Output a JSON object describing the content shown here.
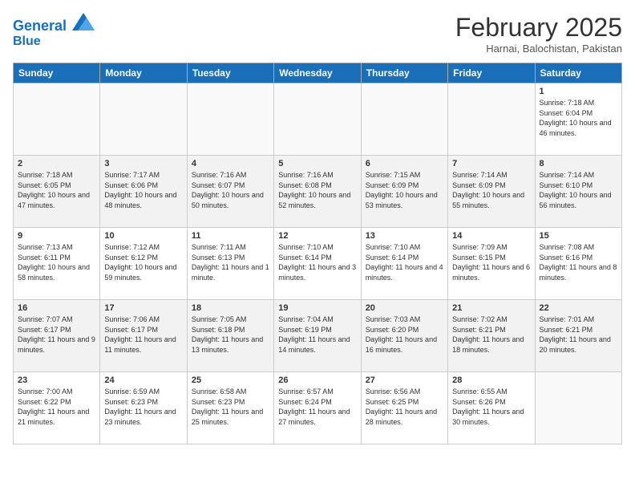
{
  "header": {
    "logo_line1": "General",
    "logo_line2": "Blue",
    "month": "February 2025",
    "location": "Harnai, Balochistan, Pakistan"
  },
  "weekdays": [
    "Sunday",
    "Monday",
    "Tuesday",
    "Wednesday",
    "Thursday",
    "Friday",
    "Saturday"
  ],
  "weeks": [
    {
      "shaded": false,
      "days": [
        {
          "num": "",
          "info": ""
        },
        {
          "num": "",
          "info": ""
        },
        {
          "num": "",
          "info": ""
        },
        {
          "num": "",
          "info": ""
        },
        {
          "num": "",
          "info": ""
        },
        {
          "num": "",
          "info": ""
        },
        {
          "num": "1",
          "info": "Sunrise: 7:18 AM\nSunset: 6:04 PM\nDaylight: 10 hours and 46 minutes."
        }
      ]
    },
    {
      "shaded": true,
      "days": [
        {
          "num": "2",
          "info": "Sunrise: 7:18 AM\nSunset: 6:05 PM\nDaylight: 10 hours and 47 minutes."
        },
        {
          "num": "3",
          "info": "Sunrise: 7:17 AM\nSunset: 6:06 PM\nDaylight: 10 hours and 48 minutes."
        },
        {
          "num": "4",
          "info": "Sunrise: 7:16 AM\nSunset: 6:07 PM\nDaylight: 10 hours and 50 minutes."
        },
        {
          "num": "5",
          "info": "Sunrise: 7:16 AM\nSunset: 6:08 PM\nDaylight: 10 hours and 52 minutes."
        },
        {
          "num": "6",
          "info": "Sunrise: 7:15 AM\nSunset: 6:09 PM\nDaylight: 10 hours and 53 minutes."
        },
        {
          "num": "7",
          "info": "Sunrise: 7:14 AM\nSunset: 6:09 PM\nDaylight: 10 hours and 55 minutes."
        },
        {
          "num": "8",
          "info": "Sunrise: 7:14 AM\nSunset: 6:10 PM\nDaylight: 10 hours and 56 minutes."
        }
      ]
    },
    {
      "shaded": false,
      "days": [
        {
          "num": "9",
          "info": "Sunrise: 7:13 AM\nSunset: 6:11 PM\nDaylight: 10 hours and 58 minutes."
        },
        {
          "num": "10",
          "info": "Sunrise: 7:12 AM\nSunset: 6:12 PM\nDaylight: 10 hours and 59 minutes."
        },
        {
          "num": "11",
          "info": "Sunrise: 7:11 AM\nSunset: 6:13 PM\nDaylight: 11 hours and 1 minute."
        },
        {
          "num": "12",
          "info": "Sunrise: 7:10 AM\nSunset: 6:14 PM\nDaylight: 11 hours and 3 minutes."
        },
        {
          "num": "13",
          "info": "Sunrise: 7:10 AM\nSunset: 6:14 PM\nDaylight: 11 hours and 4 minutes."
        },
        {
          "num": "14",
          "info": "Sunrise: 7:09 AM\nSunset: 6:15 PM\nDaylight: 11 hours and 6 minutes."
        },
        {
          "num": "15",
          "info": "Sunrise: 7:08 AM\nSunset: 6:16 PM\nDaylight: 11 hours and 8 minutes."
        }
      ]
    },
    {
      "shaded": true,
      "days": [
        {
          "num": "16",
          "info": "Sunrise: 7:07 AM\nSunset: 6:17 PM\nDaylight: 11 hours and 9 minutes."
        },
        {
          "num": "17",
          "info": "Sunrise: 7:06 AM\nSunset: 6:17 PM\nDaylight: 11 hours and 11 minutes."
        },
        {
          "num": "18",
          "info": "Sunrise: 7:05 AM\nSunset: 6:18 PM\nDaylight: 11 hours and 13 minutes."
        },
        {
          "num": "19",
          "info": "Sunrise: 7:04 AM\nSunset: 6:19 PM\nDaylight: 11 hours and 14 minutes."
        },
        {
          "num": "20",
          "info": "Sunrise: 7:03 AM\nSunset: 6:20 PM\nDaylight: 11 hours and 16 minutes."
        },
        {
          "num": "21",
          "info": "Sunrise: 7:02 AM\nSunset: 6:21 PM\nDaylight: 11 hours and 18 minutes."
        },
        {
          "num": "22",
          "info": "Sunrise: 7:01 AM\nSunset: 6:21 PM\nDaylight: 11 hours and 20 minutes."
        }
      ]
    },
    {
      "shaded": false,
      "days": [
        {
          "num": "23",
          "info": "Sunrise: 7:00 AM\nSunset: 6:22 PM\nDaylight: 11 hours and 21 minutes."
        },
        {
          "num": "24",
          "info": "Sunrise: 6:59 AM\nSunset: 6:23 PM\nDaylight: 11 hours and 23 minutes."
        },
        {
          "num": "25",
          "info": "Sunrise: 6:58 AM\nSunset: 6:23 PM\nDaylight: 11 hours and 25 minutes."
        },
        {
          "num": "26",
          "info": "Sunrise: 6:57 AM\nSunset: 6:24 PM\nDaylight: 11 hours and 27 minutes."
        },
        {
          "num": "27",
          "info": "Sunrise: 6:56 AM\nSunset: 6:25 PM\nDaylight: 11 hours and 28 minutes."
        },
        {
          "num": "28",
          "info": "Sunrise: 6:55 AM\nSunset: 6:26 PM\nDaylight: 11 hours and 30 minutes."
        },
        {
          "num": "",
          "info": ""
        }
      ]
    }
  ]
}
